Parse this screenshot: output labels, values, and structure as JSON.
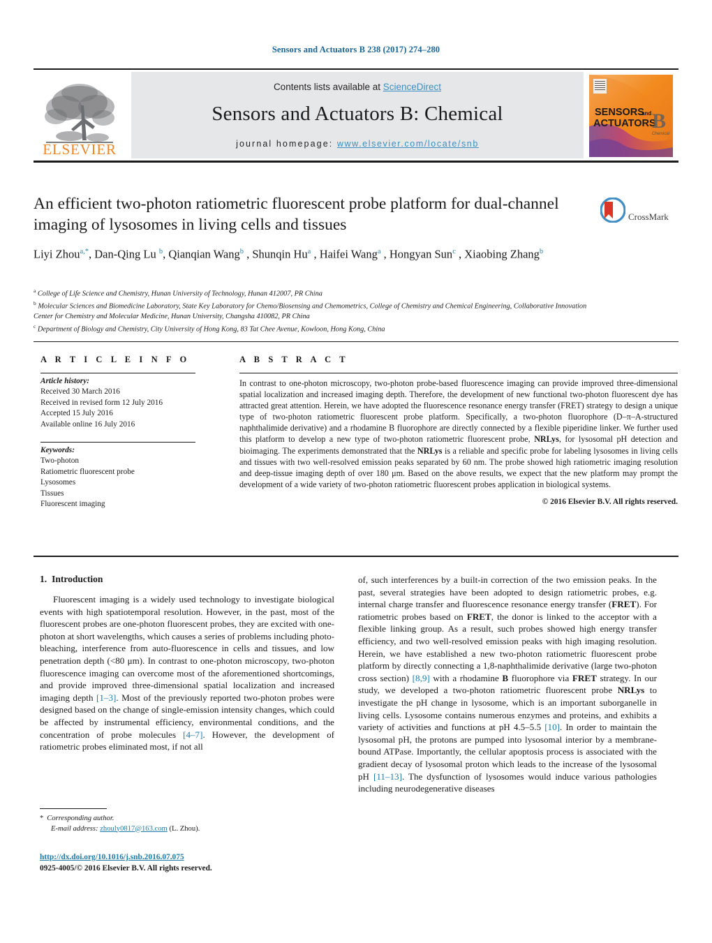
{
  "running_head": "Sensors and Actuators B 238 (2017) 274–280",
  "masthead": {
    "contents_prefix": "Contents lists available at ",
    "sciencedirect": "ScienceDirect",
    "journal_title": "Sensors and Actuators B: Chemical",
    "homepage_prefix": "journal homepage:",
    "homepage_url": "www.elsevier.com/locate/snb",
    "elsevier_wordmark": "ELSEVIER",
    "cover_line1": "SENSORS",
    "cover_and": "and",
    "cover_line2": "ACTUATORS",
    "cover_letter": "B",
    "cover_sub": "Chemical"
  },
  "crossmark": {
    "label": "CrossMark"
  },
  "article": {
    "title": "An efficient two-photon ratiometric fluorescent probe platform for dual-channel imaging of lysosomes in living cells and tissues",
    "authors_html": "Liyi Zhou<sup>a,<span class=\"star\">*</span></sup>, Dan-Qing Lu <sup>b</sup>, Qianqian Wang<sup>b</sup> , Shunqin Hu<sup>a</sup> , Haifei Wang<sup>a</sup> , Hongyan Sun<sup>c</sup> , Xiaobing Zhang<sup>b</sup>",
    "affiliations": [
      {
        "marker": "a",
        "text": "College of Life Science and Chemistry, Hunan University of Technology, Hunan 412007, PR China"
      },
      {
        "marker": "b",
        "text": "Molecular Sciences and Biomedicine Laboratory, State Key Laboratory for Chemo/Biosensing and Chemometrics, College of Chemistry and Chemical Engineering, Collaborative Innovation Center for Chemistry and Molecular Medicine, Hunan University, Changsha 410082, PR China"
      },
      {
        "marker": "c",
        "text": "Department of Biology and Chemistry, City University of Hong Kong, 83 Tat Chee Avenue, Kowloon, Hong Kong, China"
      }
    ]
  },
  "article_info": {
    "heading": "A R T I C L E   I N F O",
    "history_label": "Article history:",
    "history": [
      "Received 30 March 2016",
      "Received in revised form 12 July 2016",
      "Accepted 15 July 2016",
      "Available online 16 July 2016"
    ],
    "keywords_label": "Keywords:",
    "keywords": [
      "Two-photon",
      "Ratiometric fluorescent probe",
      "Lysosomes",
      "Tissues",
      "Fluorescent imaging"
    ]
  },
  "abstract": {
    "heading": "A B S T R A C T",
    "text_html": "In contrast to one-photon microscopy, two-photon probe-based fluorescence imaging can provide improved three-dimensional spatial localization and increased imaging depth. Therefore, the development of new functional two-photon fluorescent dye has attracted great attention. Herein, we have adopted the fluorescence resonance energy transfer (FRET) strategy to design a unique type of two-photon ratiometric fluorescent probe platform. Specifically, a two-photon fluorophore (D–&pi;–A-structured naphthalimide derivative) and a rhodamine B fluorophore are directly connected by a flexible piperidine linker. We further used this platform to develop a new type of two-photon ratiometric fluorescent probe, <b>NRLys</b>, for lysosomal pH detection and bioimaging. The experiments demonstrated that the <b>NRLys</b> is a reliable and specific probe for labeling lysosomes in living cells and tissues with two well-resolved emission peaks separated by 60 nm. The probe showed high ratiometric imaging resolution and deep-tissue imaging depth of over 180 &mu;m. Based on the above results, we expect that the new platform may prompt the development of a wide variety of two-photon ratiometric fluorescent probes application in biological systems.",
    "copyright": "© 2016 Elsevier B.V. All rights reserved."
  },
  "introduction": {
    "number": "1.",
    "heading": "Introduction",
    "left_paragraph_html": "Fluorescent imaging is a widely used technology to investigate biological events with high spatiotemporal resolution. However, in the past, most of the fluorescent probes are one-photon fluorescent probes, they are excited with one-photon at short wavelengths, which causes a series of problems including photo-bleaching, interference from auto-fluorescence in cells and tissues, and low penetration depth (&lt;80 &mu;m). In contrast to one-photon microscopy, two-photon fluorescence imaging can overcome most of the aforementioned shortcomings, and provide improved three-dimensional spatial localization and increased imaging depth <span class=\"ref\">[1–3]</span>. Most of the previously reported two-photon probes were designed based on the change of single-emission intensity changes, which could be affected by instrumental efficiency, environmental conditions, and the concentration of probe molecules <span class=\"ref\">[4–7]</span>. However, the development of ratiometric probes eliminated most, if not all",
    "right_paragraph_html": "of, such interferences by a built-in correction of the two emission peaks. In the past, several strategies have been adopted to design ratiometric probes, e.g. internal charge transfer and fluorescence resonance energy transfer (<b>FRET</b>). For ratiometric probes based on <b>FRET</b>, the donor is linked to the acceptor with a flexible linking group. As a result, such probes showed high energy transfer efficiency, and two well-resolved emission peaks with high imaging resolution. Herein, we have established a new two-photon ratiometric fluorescent probe platform by directly connecting a 1,8-naphthalimide derivative (large two-photon cross section) <span class=\"ref\">[8,9]</span> with a rhodamine <b>B</b> fluorophore via <b>FRET</b> strategy. In our study, we developed a two-photon ratiometric fluorescent probe <b>NRLys</b> to investigate the pH change in lysosome, which is an important suborganelle in living cells. Lysosome contains numerous enzymes and proteins, and exhibits a variety of activities and functions at pH 4.5–5.5 <span class=\"ref\">[10]</span>. In order to maintain the lysosomal pH, the protons are pumped into lysosomal interior by a membrane-bound ATPase. Importantly, the cellular apoptosis process is associated with the gradient decay of lysosomal proton which leads to the increase of the lysosomal pH <span class=\"ref\">[11–13]</span>. The dysfunction of lysosomes would induce various pathologies including neurodegenerative diseases"
  },
  "footer": {
    "corresponding_star": "*",
    "corresponding_author": "Corresponding author.",
    "email_label": "E-mail address:",
    "email": "zhouly0817@163.com",
    "email_suffix": "(L. Zhou).",
    "doi_url": "http://dx.doi.org/10.1016/j.snb.2016.07.075",
    "issn_line": "0925-4005/© 2016 Elsevier B.V. All rights reserved."
  },
  "colors": {
    "link_blue": "#1f7ba8",
    "sciencedirect_blue": "#3c8fc0",
    "elsevier_orange": "#f08521",
    "band_gray": "#e6e7e8"
  }
}
